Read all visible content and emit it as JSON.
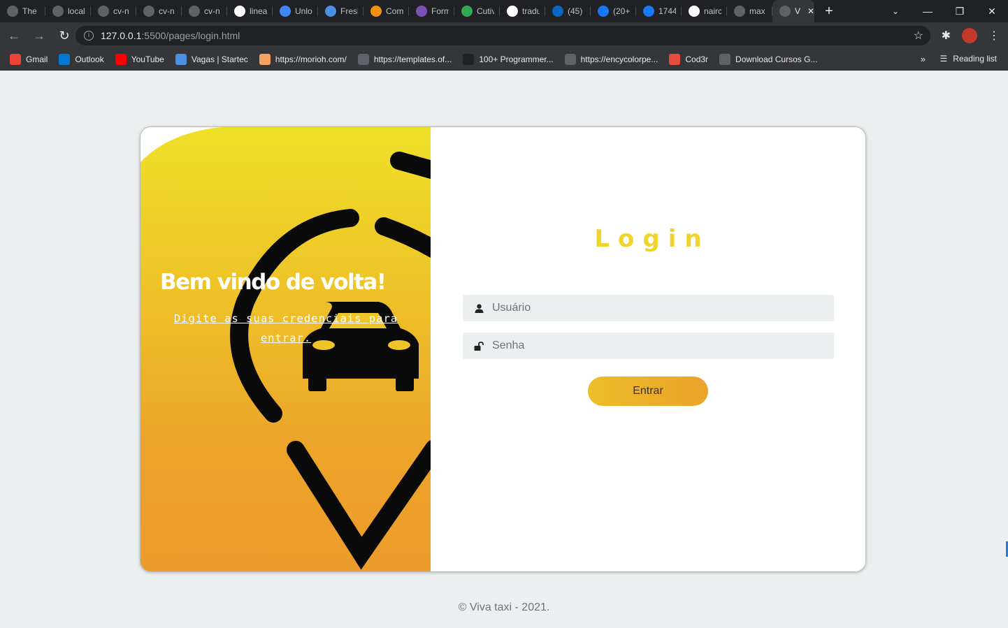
{
  "browser": {
    "tabs": [
      {
        "title": "The |",
        "icon": "globe-icon",
        "color": "#5f6368"
      },
      {
        "title": "local",
        "icon": "react-icon",
        "color": "#5f6368"
      },
      {
        "title": "cv-n",
        "icon": "globe-icon",
        "color": "#5f6368"
      },
      {
        "title": "cv-n",
        "icon": "globe-icon",
        "color": "#5f6368"
      },
      {
        "title": "cv-n",
        "icon": "globe-icon",
        "color": "#5f6368"
      },
      {
        "title": "linea",
        "icon": "google-icon",
        "color": "#ffffff"
      },
      {
        "title": "Unlo",
        "icon": "flag-icon",
        "color": "#4285f4"
      },
      {
        "title": "Fresl",
        "icon": "fresh-icon",
        "color": "#4a90e2"
      },
      {
        "title": "Com",
        "icon": "w-icon",
        "color": "#f29111"
      },
      {
        "title": "Form",
        "icon": "bootstrap-icon",
        "color": "#7952b3"
      },
      {
        "title": "Cutiv",
        "icon": "cutiv-icon",
        "color": "#34a853"
      },
      {
        "title": "tradu",
        "icon": "google-icon",
        "color": "#ffffff"
      },
      {
        "title": "(45)",
        "icon": "linkedin-icon",
        "color": "#0a66c2"
      },
      {
        "title": "(20+",
        "icon": "facebook-icon",
        "color": "#1877f2"
      },
      {
        "title": "1744",
        "icon": "facebook-icon",
        "color": "#1877f2"
      },
      {
        "title": "nairc",
        "icon": "github-icon",
        "color": "#ffffff"
      },
      {
        "title": "max",
        "icon": "globe-icon",
        "color": "#5f6368"
      }
    ],
    "active_tab": {
      "title": "V",
      "close": "✕"
    },
    "new_tab": "+",
    "window_controls": {
      "minimize": "—",
      "restore": "❐",
      "close": "✕"
    },
    "url_host": "127.0.0.1",
    "url_path": ":5500/pages/login.html",
    "bookmarks": [
      {
        "label": "Gmail",
        "icon": "gmail-icon",
        "color": "#ea4335"
      },
      {
        "label": "Outlook",
        "icon": "outlook-icon",
        "color": "#0078d4"
      },
      {
        "label": "YouTube",
        "icon": "youtube-icon",
        "color": "#ff0000"
      },
      {
        "label": "Vagas | Startec",
        "icon": "startec-icon",
        "color": "#4a90e2"
      },
      {
        "label": "https://morioh.com/",
        "icon": "morioh-icon",
        "color": "#f4a261"
      },
      {
        "label": "https://templates.of...",
        "icon": "globe-icon",
        "color": "#5f6368"
      },
      {
        "label": "100+ Programmer...",
        "icon": "programmer-icon",
        "color": "#202124"
      },
      {
        "label": "https://encycolorpe...",
        "icon": "globe-icon",
        "color": "#5f6368"
      },
      {
        "label": "Cod3r",
        "icon": "cod3r-icon",
        "color": "#e74c3c"
      },
      {
        "label": "Download Cursos G...",
        "icon": "globe-icon",
        "color": "#5f6368"
      }
    ],
    "bookmarks_more": "»",
    "reading_list": "Reading list"
  },
  "page": {
    "welcome_title": "Bem vindo de volta!",
    "welcome_text": "Digite as suas credenciais para entrar.",
    "login_title": "Login",
    "username_placeholder": "Usuário",
    "password_placeholder": "Senha",
    "submit_label": "Entrar",
    "footer": "© Viva taxi - 2021.",
    "colors": {
      "accent_yellow": "#efd42b",
      "gradient_top": "#efe029",
      "gradient_bottom": "#ec9b2a",
      "field_bg": "#eceff0"
    }
  }
}
